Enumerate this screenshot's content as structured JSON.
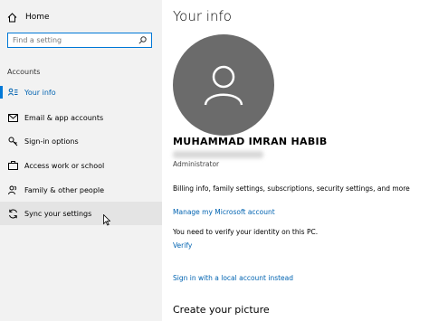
{
  "sidebar": {
    "home_label": "Home",
    "search_placeholder": "Find a setting",
    "section_label": "Accounts",
    "items": [
      {
        "label": "Your info",
        "icon": "person-card-icon",
        "active": true
      },
      {
        "label": "Email & app accounts",
        "icon": "mail-icon"
      },
      {
        "label": "Sign-in options",
        "icon": "key-icon"
      },
      {
        "label": "Access work or school",
        "icon": "briefcase-icon"
      },
      {
        "label": "Family & other people",
        "icon": "people-icon"
      },
      {
        "label": "Sync your settings",
        "icon": "sync-icon",
        "hover": true
      }
    ]
  },
  "main": {
    "title": "Your info",
    "user_name": "MUHAMMAD IMRAN HABIB",
    "role": "Administrator",
    "billing_text": "Billing info, family settings, subscriptions, security settings, and more",
    "manage_link": "Manage my Microsoft account",
    "verify_text": "You need to verify your identity on this PC.",
    "verify_link": "Verify",
    "local_account_link": "Sign in with a local account instead",
    "create_picture": "Create your picture"
  },
  "colors": {
    "accent": "#0078d7",
    "link": "#0063b1",
    "sidebar_bg": "#f2f2f2",
    "avatar_bg": "#6b6b6b"
  }
}
